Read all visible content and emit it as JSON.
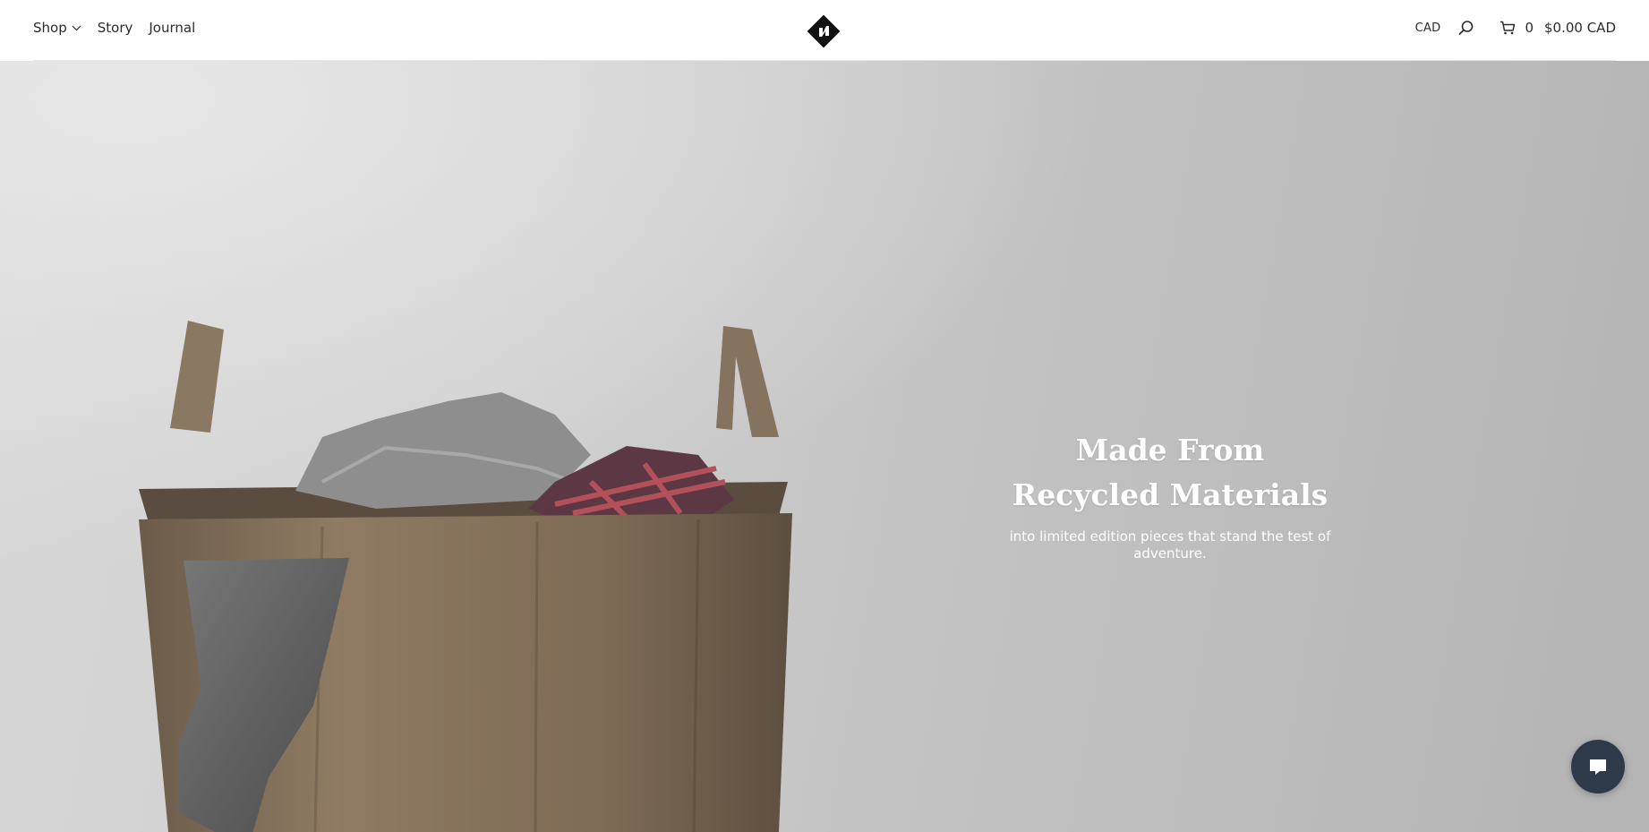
{
  "header": {
    "nav": {
      "shop": "Shop",
      "story": "Story",
      "journal": "Journal"
    },
    "logo_icon": "diamond-logo",
    "currency": "CAD",
    "search_icon": "search-icon",
    "cart": {
      "icon": "cart-icon",
      "count": "0",
      "total": "$0.00 CAD"
    }
  },
  "hero": {
    "title": "Made From Recycled Materials",
    "subtitle": "into limited edition pieces that stand the test of adventure."
  },
  "chat": {
    "icon": "chat-bubble-icon"
  },
  "colors": {
    "header_bg": "#ffffff",
    "text": "#2b2b2b",
    "hero_text": "#ffffff",
    "chat_button": "#2e3a4a"
  }
}
